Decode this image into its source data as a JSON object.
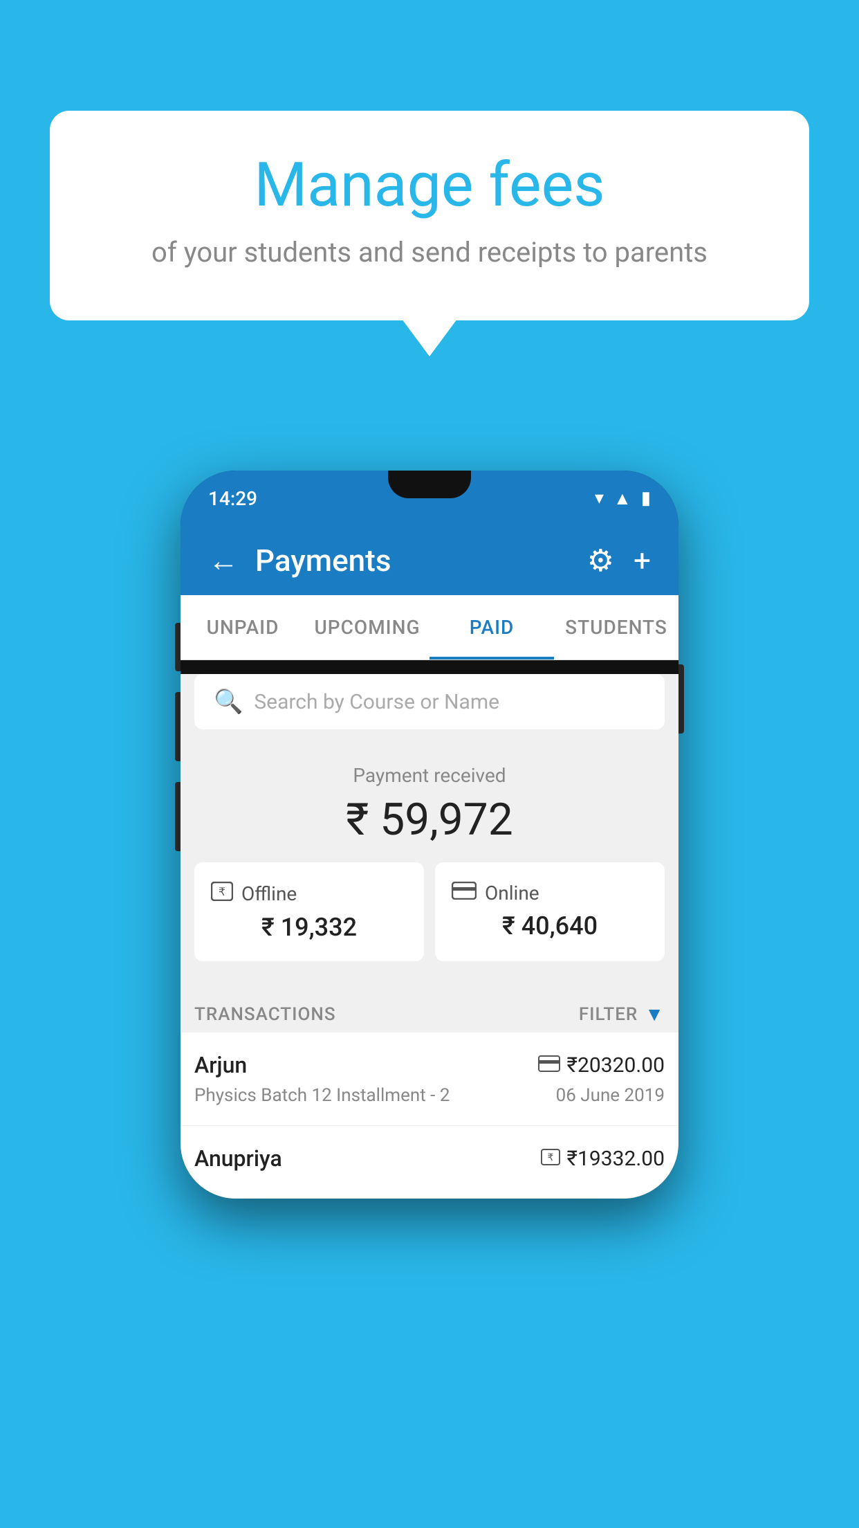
{
  "background_color": "#29b6e8",
  "speech_bubble": {
    "title": "Manage fees",
    "subtitle": "of your students and send receipts to parents"
  },
  "phone": {
    "time": "14:29",
    "header": {
      "back_label": "←",
      "title": "Payments",
      "gear_icon": "⚙",
      "plus_icon": "+"
    },
    "tabs": [
      {
        "label": "UNPAID",
        "active": false
      },
      {
        "label": "UPCOMING",
        "active": false
      },
      {
        "label": "PAID",
        "active": true
      },
      {
        "label": "STUDENTS",
        "active": false
      }
    ],
    "search": {
      "placeholder": "Search by Course or Name"
    },
    "payment_received": {
      "label": "Payment received",
      "amount": "₹ 59,972",
      "offline": {
        "type": "Offline",
        "amount": "₹ 19,332"
      },
      "online": {
        "type": "Online",
        "amount": "₹ 40,640"
      }
    },
    "transactions": {
      "label": "TRANSACTIONS",
      "filter_label": "FILTER",
      "items": [
        {
          "name": "Arjun",
          "amount": "₹20320.00",
          "detail": "Physics Batch 12 Installment - 2",
          "date": "06 June 2019",
          "payment_type": "card"
        },
        {
          "name": "Anupriya",
          "amount": "₹19332.00",
          "detail": "",
          "date": "",
          "payment_type": "offline"
        }
      ]
    }
  }
}
